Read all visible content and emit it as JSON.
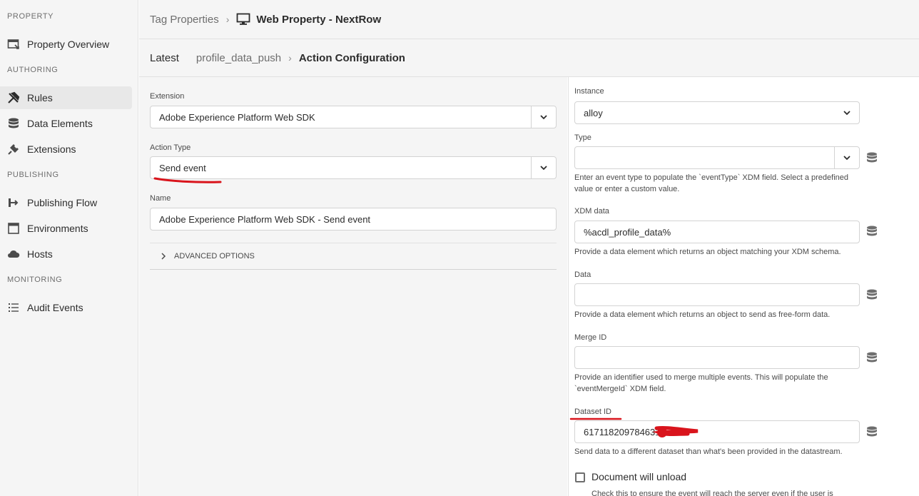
{
  "sidebar": {
    "sections": [
      {
        "title": "PROPERTY",
        "items": [
          {
            "label": "Property Overview",
            "icon": "property-overview-icon"
          }
        ]
      },
      {
        "title": "AUTHORING",
        "items": [
          {
            "label": "Rules",
            "icon": "rules-icon",
            "active": true
          },
          {
            "label": "Data Elements",
            "icon": "data-elements-icon"
          },
          {
            "label": "Extensions",
            "icon": "extensions-icon"
          }
        ]
      },
      {
        "title": "PUBLISHING",
        "items": [
          {
            "label": "Publishing Flow",
            "icon": "publishing-flow-icon"
          },
          {
            "label": "Environments",
            "icon": "environments-icon"
          },
          {
            "label": "Hosts",
            "icon": "hosts-icon"
          }
        ]
      },
      {
        "title": "MONITORING",
        "items": [
          {
            "label": "Audit Events",
            "icon": "audit-events-icon"
          }
        ]
      }
    ]
  },
  "header": {
    "crumb_root": "Tag Properties",
    "crumb_property": "Web Property - NextRow"
  },
  "subheader": {
    "latest": "Latest",
    "rule": "profile_data_push",
    "current": "Action Configuration"
  },
  "left": {
    "extension_label": "Extension",
    "extension_value": "Adobe Experience Platform Web SDK",
    "action_type_label": "Action Type",
    "action_type_value": "Send event",
    "name_label": "Name",
    "name_value": "Adobe Experience Platform Web SDK - Send event",
    "advanced_label": "ADVANCED OPTIONS"
  },
  "right": {
    "instance_label": "Instance",
    "instance_value": "alloy",
    "type_label": "Type",
    "type_value": "",
    "type_help": "Enter an event type to populate the `eventType` XDM field. Select a predefined value or enter a custom value.",
    "xdm_label": "XDM data",
    "xdm_value": "%acdl_profile_data%",
    "xdm_help": "Provide a data element which returns an object matching your XDM schema.",
    "data_label": "Data",
    "data_value": "",
    "data_help": "Provide a data element which returns an object to send as free-form data.",
    "merge_label": "Merge ID",
    "merge_value": "",
    "merge_help": "Provide an identifier used to merge multiple events. This will populate the `eventMergeId` XDM field.",
    "dataset_label": "Dataset ID",
    "dataset_value": "6171182097846319",
    "dataset_help": "Send data to a different dataset than what's been provided in the datastream.",
    "unload_label": "Document will unload",
    "unload_help": "Check this to ensure the event will reach the server even if the user is"
  },
  "colors": {
    "annotation": "#d9141c",
    "sidebar_bg": "#f5f5f5"
  }
}
